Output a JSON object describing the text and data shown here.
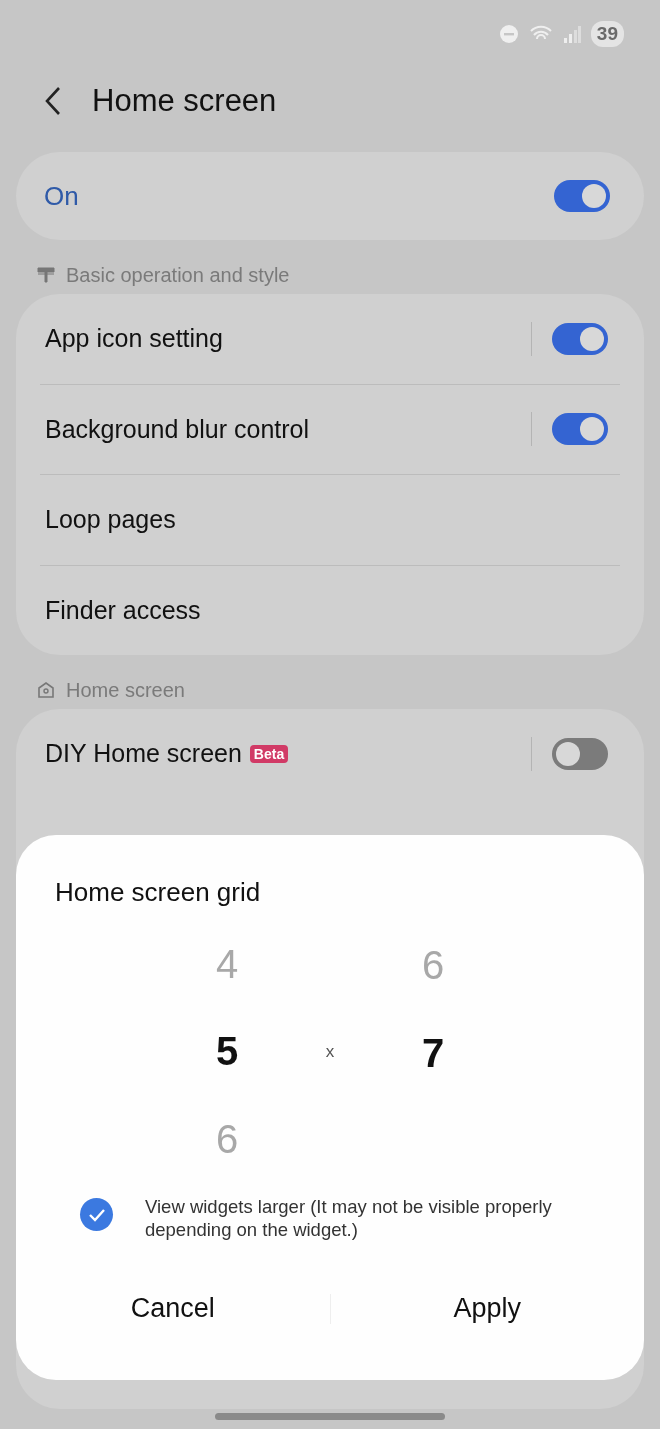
{
  "status_bar": {
    "battery": "39"
  },
  "header": {
    "title": "Home screen"
  },
  "master_switch": {
    "label": "On",
    "on": true
  },
  "sections": [
    {
      "title": "Basic operation and style",
      "items": [
        {
          "label": "App icon setting",
          "kind": "switch",
          "on": true
        },
        {
          "label": "Background blur control",
          "kind": "switch",
          "on": true
        },
        {
          "label": "Loop pages",
          "kind": "link"
        },
        {
          "label": "Finder access",
          "kind": "link"
        }
      ]
    },
    {
      "title": "Home screen",
      "items": [
        {
          "label": "DIY Home screen",
          "badge": "Beta",
          "kind": "switch",
          "on": false
        }
      ]
    }
  ],
  "dialog": {
    "title": "Home screen grid",
    "separator": "x",
    "pickers": [
      {
        "values": [
          {
            "value": "4",
            "selected": false
          },
          {
            "value": "5",
            "selected": true
          },
          {
            "value": "6",
            "selected": false
          }
        ]
      },
      {
        "values": [
          {
            "value": "6",
            "selected": false
          },
          {
            "value": "7",
            "selected": true
          }
        ]
      }
    ],
    "checkbox": {
      "label": "View widgets larger (It may not be visible properly depending on the widget.)",
      "checked": true
    },
    "buttons": [
      "Cancel",
      "Apply"
    ]
  }
}
